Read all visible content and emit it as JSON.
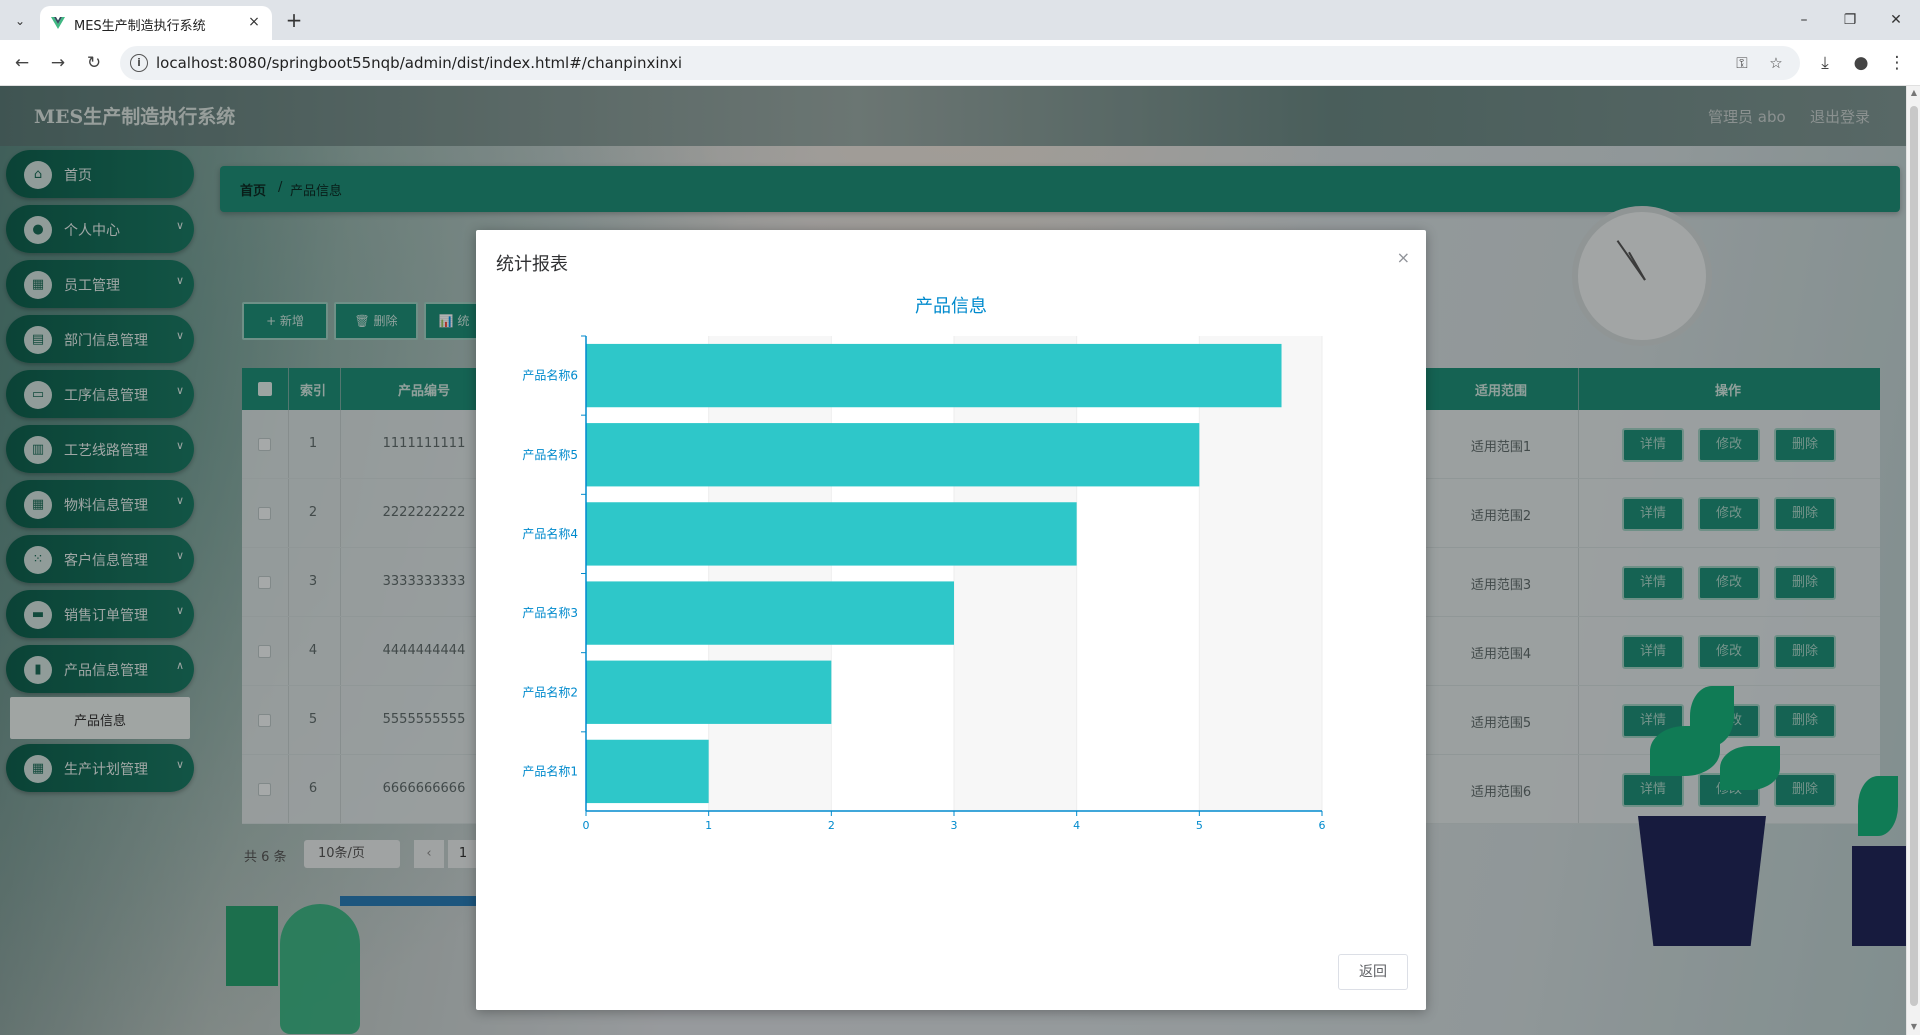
{
  "browser": {
    "tab_title": "MES生产制造执行系统",
    "url": "localhost:8080/springboot55nqb/admin/dist/index.html#/chanpinxinxi",
    "new_tab": "+",
    "close": "×"
  },
  "header": {
    "title": "MES生产制造执行系统",
    "user": "管理员 abo",
    "logout": "退出登录"
  },
  "sidebar": {
    "items": [
      {
        "label": "首页",
        "icon": "home-icon",
        "glyph": "⌂"
      },
      {
        "label": "个人中心",
        "icon": "user-icon",
        "glyph": "●"
      },
      {
        "label": "员工管理",
        "icon": "grid-icon",
        "glyph": "▦"
      },
      {
        "label": "部门信息管理",
        "icon": "chart-icon",
        "glyph": "▤"
      },
      {
        "label": "工序信息管理",
        "icon": "chat-icon",
        "glyph": "▭"
      },
      {
        "label": "工艺线路管理",
        "icon": "document-icon",
        "glyph": "▥"
      },
      {
        "label": "物料信息管理",
        "icon": "grid-icon",
        "glyph": "▦"
      },
      {
        "label": "客户信息管理",
        "icon": "apps-icon",
        "glyph": "⁙"
      },
      {
        "label": "销售订单管理",
        "icon": "monitor-icon",
        "glyph": "▬"
      },
      {
        "label": "产品信息管理",
        "icon": "book-icon",
        "glyph": "▮"
      },
      {
        "label": "生产计划管理",
        "icon": "grid-icon",
        "glyph": "▦"
      }
    ],
    "active_sub": "产品信息"
  },
  "breadcrumb": {
    "home": "首页",
    "sep": "/",
    "current": "产品信息"
  },
  "toolbar": {
    "add": "+ 新增",
    "delete": "🗑 删除",
    "stats": "📊 统"
  },
  "table": {
    "headers": {
      "index": "索引",
      "code": "产品编号",
      "scope": "适用范围",
      "ops": "操作"
    },
    "rows": [
      {
        "index": "1",
        "code": "1111111111",
        "scope": "适用范围1"
      },
      {
        "index": "2",
        "code": "2222222222",
        "scope": "适用范围2"
      },
      {
        "index": "3",
        "code": "3333333333",
        "scope": "适用范围3"
      },
      {
        "index": "4",
        "code": "4444444444",
        "scope": "适用范围4"
      },
      {
        "index": "5",
        "code": "5555555555",
        "scope": "适用范围5"
      },
      {
        "index": "6",
        "code": "6666666666",
        "scope": "适用范围6"
      }
    ],
    "buttons": {
      "detail": "详情",
      "edit": "修改",
      "remove": "删除"
    }
  },
  "pager": {
    "total": "共 6 条",
    "size": "10条/页",
    "prev": "‹",
    "page": "1"
  },
  "modal": {
    "title": "统计报表",
    "close": "×",
    "return": "返回"
  },
  "colors": {
    "bar": "#2ec7c9",
    "axis": "#008acd",
    "teal": "#1f8e77"
  },
  "chart_data": {
    "type": "bar",
    "orientation": "horizontal",
    "title": "产品信息",
    "categories": [
      "产品名称1",
      "产品名称2",
      "产品名称3",
      "产品名称4",
      "产品名称5",
      "产品名称6"
    ],
    "values": [
      1,
      2,
      3,
      4,
      5,
      5.67
    ],
    "xlim": [
      0,
      6
    ],
    "xticks": [
      "0",
      "1",
      "2",
      "3",
      "4",
      "5",
      "6"
    ],
    "grid": "split-area bands"
  }
}
